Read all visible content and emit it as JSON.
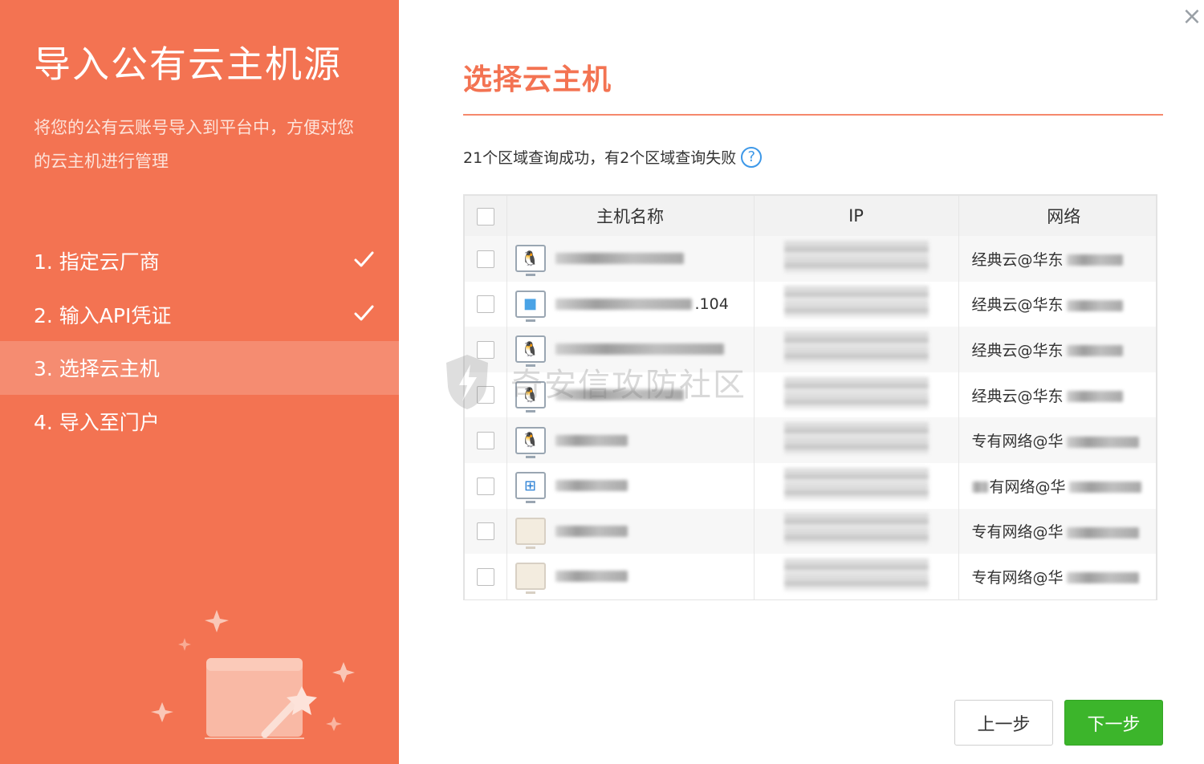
{
  "sidebar": {
    "title": "导入公有云主机源",
    "description": "将您的公有云账号导入到平台中，方便对您的云主机进行管理",
    "steps": [
      {
        "label": "1. 指定云厂商",
        "done": true
      },
      {
        "label": "2. 输入API凭证",
        "done": true
      },
      {
        "label": "3. 选择云主机",
        "active": true
      },
      {
        "label": "4. 导入至门户"
      }
    ]
  },
  "main": {
    "title": "选择云主机",
    "status_text": "21个区域查询成功，有2个区域查询失败",
    "help_label": "?",
    "table": {
      "columns": [
        "主机名称",
        "IP",
        "网络"
      ],
      "rows": [
        {
          "os": "linux-icon",
          "name_suffix": "",
          "ip_hint": "10.252.80.160（内）",
          "network": "经典云@华东"
        },
        {
          "os": "windows-icon",
          "name_suffix": ".104",
          "ip_hint": "",
          "network": "经典云@华东"
        },
        {
          "os": "linux-icon",
          "name_suffix": "",
          "ip_hint": "10",
          "network": "经典云@华东"
        },
        {
          "os": "linux-icon",
          "name_suffix": "",
          "ip_hint": "",
          "network": "经典云@华东"
        },
        {
          "os": "linux-icon",
          "name_suffix": "",
          "ip_hint": "1",
          "network": "专有网络@华"
        },
        {
          "os": "windows-icon",
          "name_suffix": "",
          "ip_hint": "",
          "network": "有网络@华"
        },
        {
          "os": "image-icon",
          "name_suffix": "",
          "ip_hint": "",
          "network": "专有网络@华"
        },
        {
          "os": "image-icon",
          "name_suffix": "",
          "ip_hint": "",
          "network": "专有网络@华"
        }
      ]
    }
  },
  "buttons": {
    "prev": "上一步",
    "next": "下一步"
  },
  "watermark": "奇安信攻防社区",
  "colors": {
    "sidebar_bg": "#f37352",
    "active_step_bg": "#f58c71",
    "accent": "#f37352",
    "next_button": "#3cb52b",
    "help_icon": "#3d98e8"
  }
}
